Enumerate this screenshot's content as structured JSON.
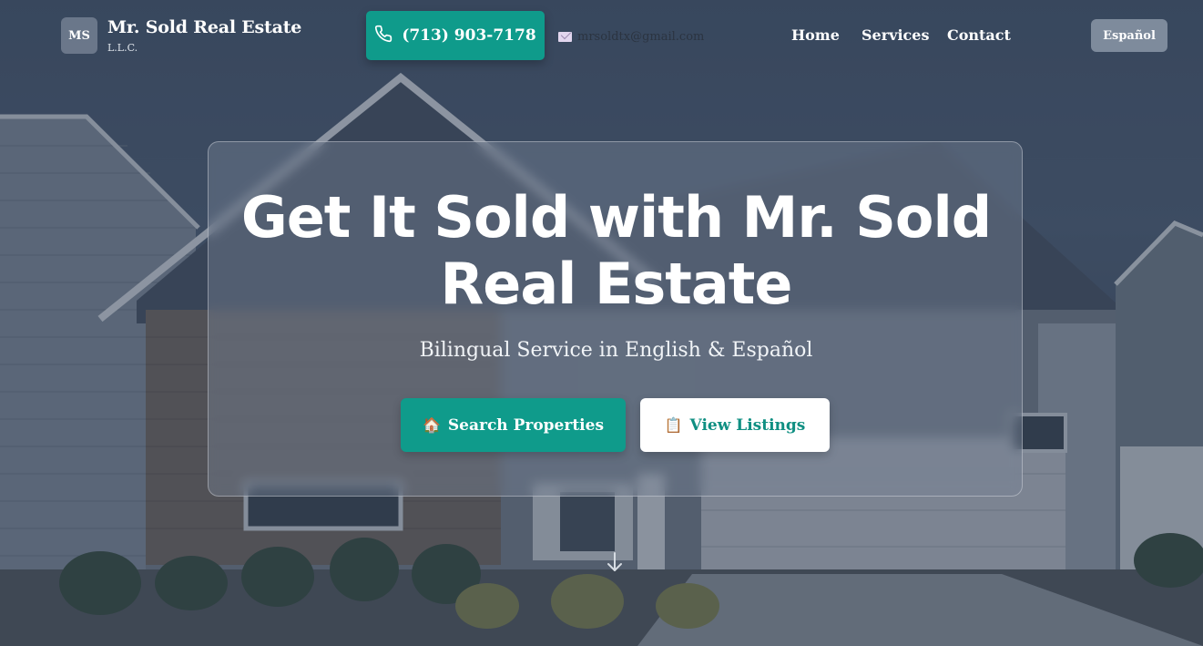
{
  "brand": {
    "badge": "MS",
    "name": "Mr. Sold Real Estate",
    "subtitle": "L.L.C."
  },
  "contact": {
    "phone": "(713) 903-7178",
    "phone_icon": "phone-icon",
    "email": "mrsoldtx@gmail.com",
    "email_icon": "envelope-icon"
  },
  "nav": {
    "items": [
      {
        "label": "Home"
      },
      {
        "label": "Services"
      },
      {
        "label": "Contact"
      }
    ],
    "language_toggle": "Español"
  },
  "hero": {
    "title": "Get It Sold with Mr. Sold Real Estate",
    "subtitle": "Bilingual Service in English & Español",
    "primary_button": {
      "icon": "🏠",
      "label": "Search Properties"
    },
    "secondary_button": {
      "icon": "📋",
      "label": "View Listings"
    },
    "scroll_icon": "arrow-down-icon"
  },
  "colors": {
    "accent": "#0f9b8b",
    "overlay": "#1e2d42",
    "secondary_text": "#0f8f82"
  }
}
